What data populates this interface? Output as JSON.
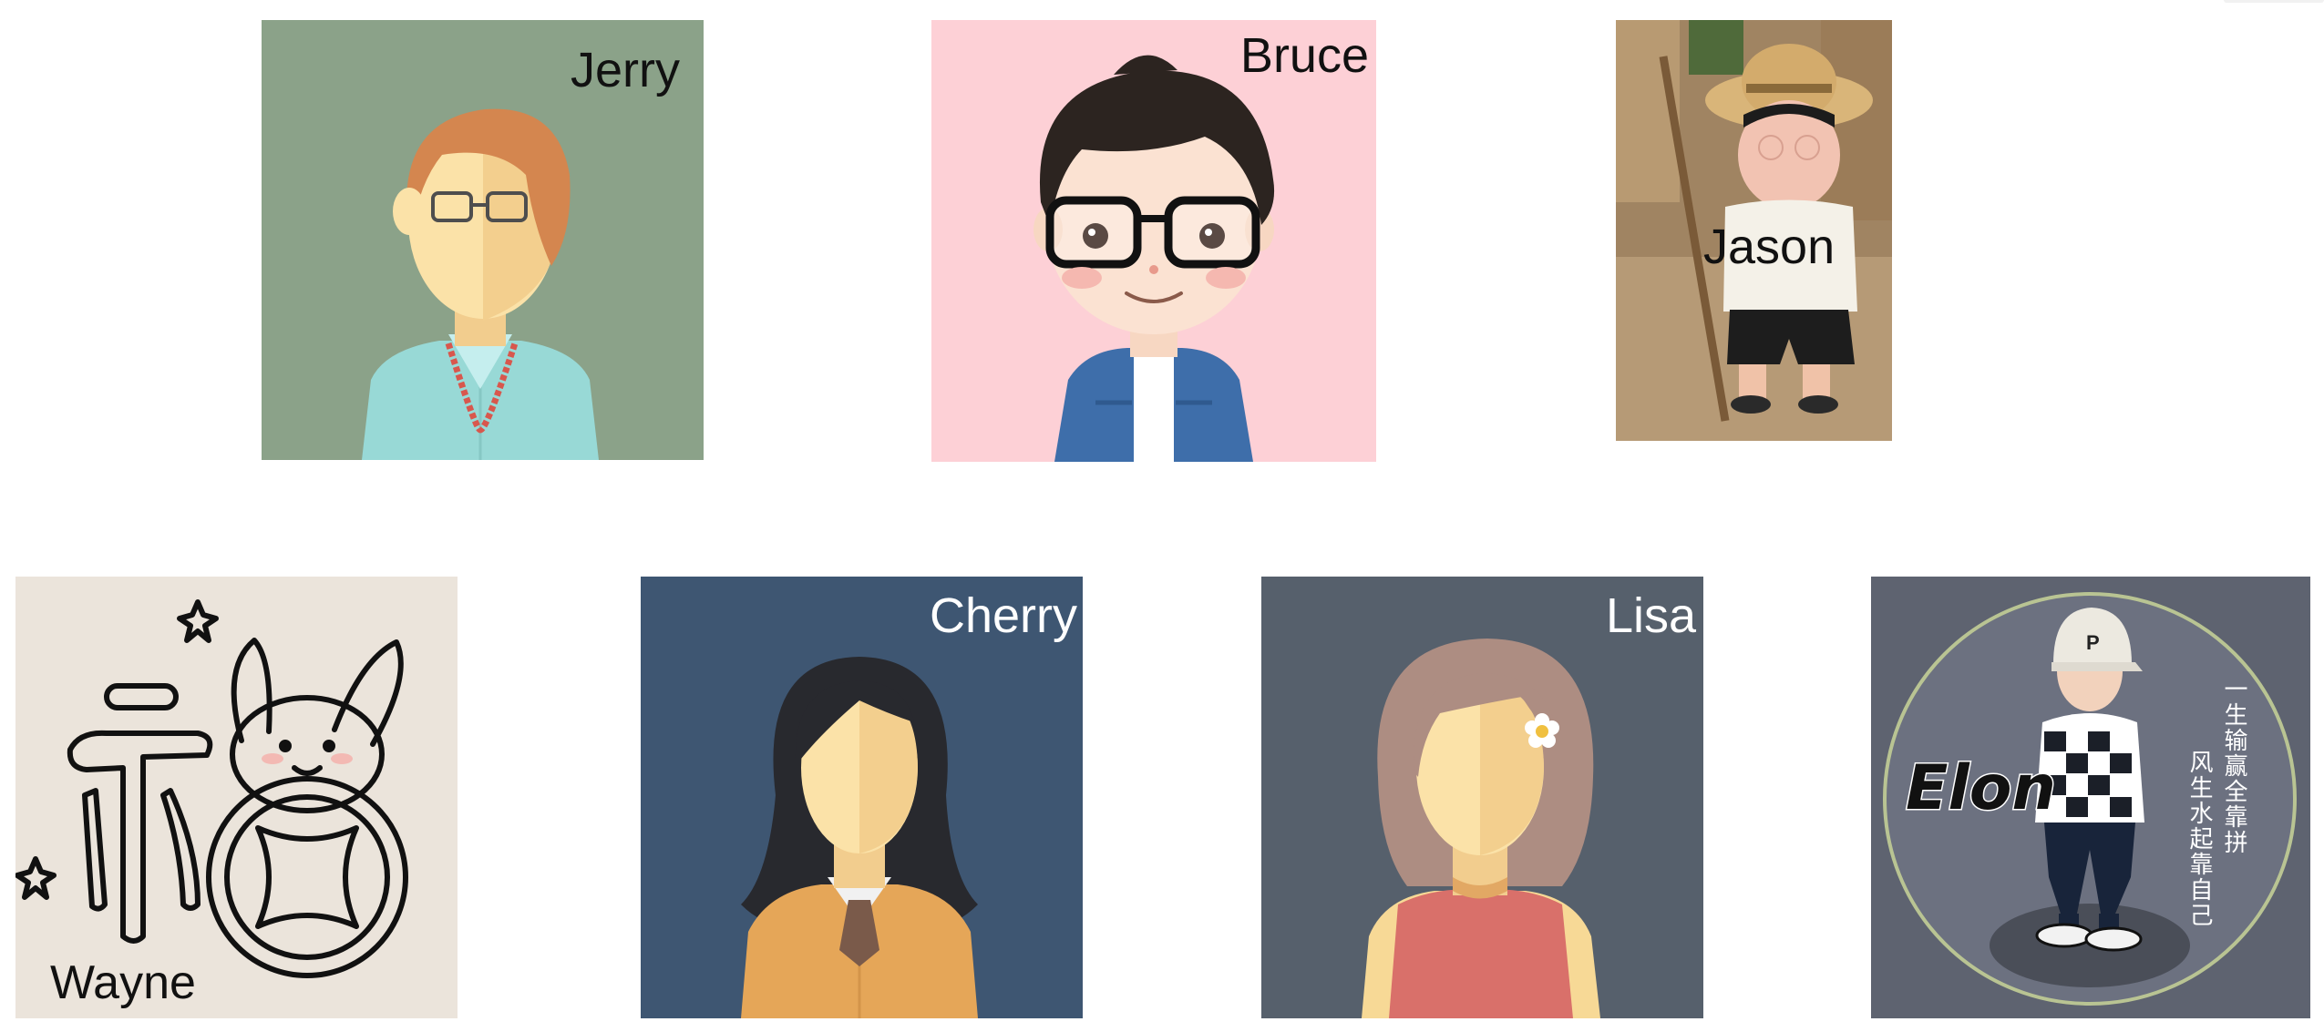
{
  "avatars": [
    {
      "name": "Jerry",
      "background": "#8ba289",
      "icon": "woman-red-hair-glasses-avatar"
    },
    {
      "name": "Bruce",
      "background": "#fdd0d6",
      "icon": "cartoon-boy-glasses-avatar"
    },
    {
      "name": "Jason",
      "background": "#a08462",
      "icon": "child-straw-hat-photo"
    },
    {
      "name": "Wayne",
      "background": "#ebe4db",
      "icon": "fu-character-rabbit-coin"
    },
    {
      "name": "Cherry",
      "background": "#3e5672",
      "icon": "woman-dark-hair-avatar"
    },
    {
      "name": "Lisa",
      "background": "#56606c",
      "icon": "woman-brown-hair-flower-avatar"
    },
    {
      "name": "Elon",
      "background": "#5e6370",
      "icon": "streetwear-character-badge",
      "poem_lines": [
        "一生输赢全靠拼",
        "风生水起靠自己"
      ]
    }
  ]
}
